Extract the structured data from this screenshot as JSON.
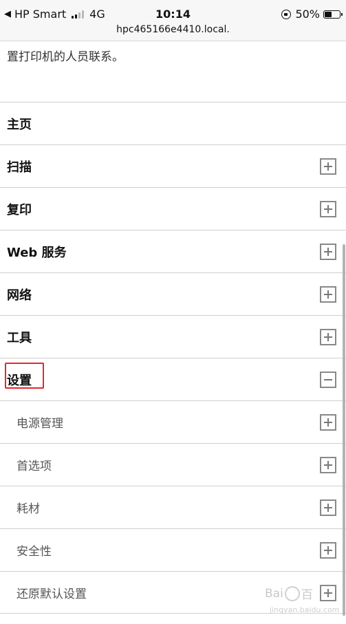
{
  "status_bar": {
    "back_app": "HP Smart",
    "network": "4G",
    "time": "10:14",
    "battery": "50%",
    "battery_level": 0.5,
    "url": "hpc465166e4410.local."
  },
  "notice_text": "置打印机的人员联系。",
  "menu": {
    "home": "主页",
    "scan": "扫描",
    "copy": "复印",
    "web_services": "Web 服务",
    "network": "网络",
    "tools": "工具",
    "settings": "设置",
    "power_management": "电源管理",
    "preferences": "首选项",
    "supplies": "耗材",
    "security": "安全性",
    "restore_defaults": "还原默认设置"
  },
  "watermark": {
    "brand_left": "Bai",
    "brand_right": "百",
    "sub": "jingyan.baidu.com"
  },
  "colors": {
    "highlight": "#e0282e"
  }
}
